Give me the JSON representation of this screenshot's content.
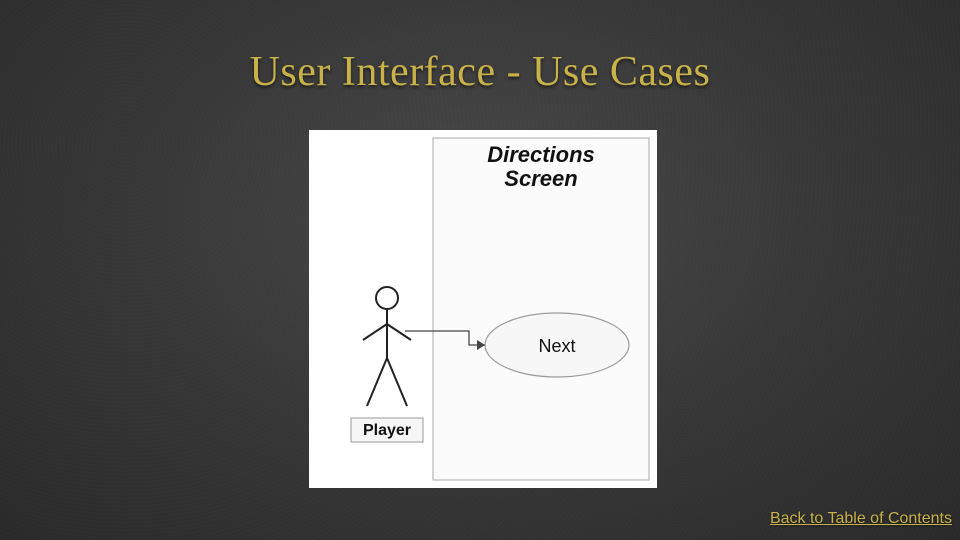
{
  "title": "User Interface - Use Cases",
  "footer_link": "Back to Table of Contents",
  "diagram": {
    "system_label": "Directions Screen",
    "actor_label": "Player",
    "usecase_label": "Next"
  }
}
